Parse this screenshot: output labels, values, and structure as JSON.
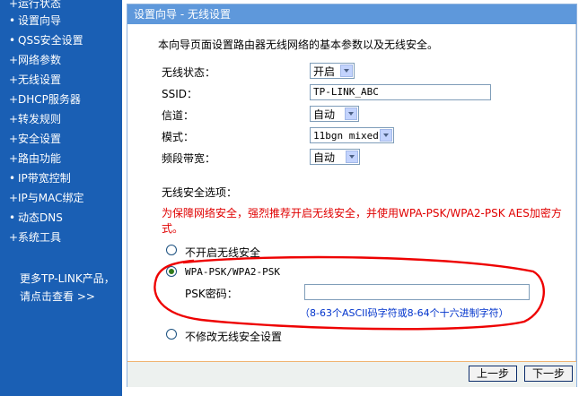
{
  "sidebar": {
    "items": [
      {
        "label": "运行状态",
        "id": "status"
      },
      {
        "label": "设置向导",
        "id": "wizard"
      },
      {
        "label": "QSS安全设置",
        "id": "qss"
      },
      {
        "label": "网络参数",
        "id": "network"
      },
      {
        "label": "无线设置",
        "id": "wireless"
      },
      {
        "label": "DHCP服务器",
        "id": "dhcp"
      },
      {
        "label": "转发规则",
        "id": "forwarding"
      },
      {
        "label": "安全设置",
        "id": "security"
      },
      {
        "label": "路由功能",
        "id": "routing"
      },
      {
        "label": "IP带宽控制",
        "id": "bandwidth"
      },
      {
        "label": "IP与MAC绑定",
        "id": "ipmac"
      },
      {
        "label": "动态DNS",
        "id": "ddns"
      },
      {
        "label": "系统工具",
        "id": "tools"
      }
    ],
    "promo_line1": "更多TP-LINK产品，",
    "promo_line2": "请点击查看 >>"
  },
  "panel": {
    "title": "设置向导 - 无线设置",
    "intro": "本向导页面设置路由器无线网络的基本参数以及无线安全。",
    "fields": {
      "wireless_status_label": "无线状态：",
      "wireless_status_value": "开启",
      "ssid_label": "SSID：",
      "ssid_value": "TP-LINK_ABC",
      "channel_label": "信道：",
      "channel_value": "自动",
      "mode_label": "模式：",
      "mode_value": "11bgn mixed",
      "bandwidth_label": "频段带宽：",
      "bandwidth_value": "自动"
    },
    "security": {
      "heading": "无线安全选项：",
      "warning_line1": "为保障网络安全，强烈推荐开启无线安全，并使用WPA-PSK/WPA2-PSK AES加密方",
      "warning_line2": "式。",
      "opt_none": "不开启无线安全",
      "opt_wpa": "WPA-PSK/WPA2-PSK",
      "psk_label": "PSK密码：",
      "psk_value": "",
      "psk_hint": "（8-63个ASCII码字符或8-64个十六进制字符）",
      "opt_keep": "不修改无线安全设置",
      "selected": "wpa"
    },
    "buttons": {
      "prev": "上一步",
      "next": "下一步"
    }
  },
  "colors": {
    "sidebar_bg": "#1a5fb4",
    "title_bar": "#5e98db",
    "warning_text": "#e00000",
    "hint_text": "#0033cc",
    "annotation_circle": "#ee0000"
  }
}
